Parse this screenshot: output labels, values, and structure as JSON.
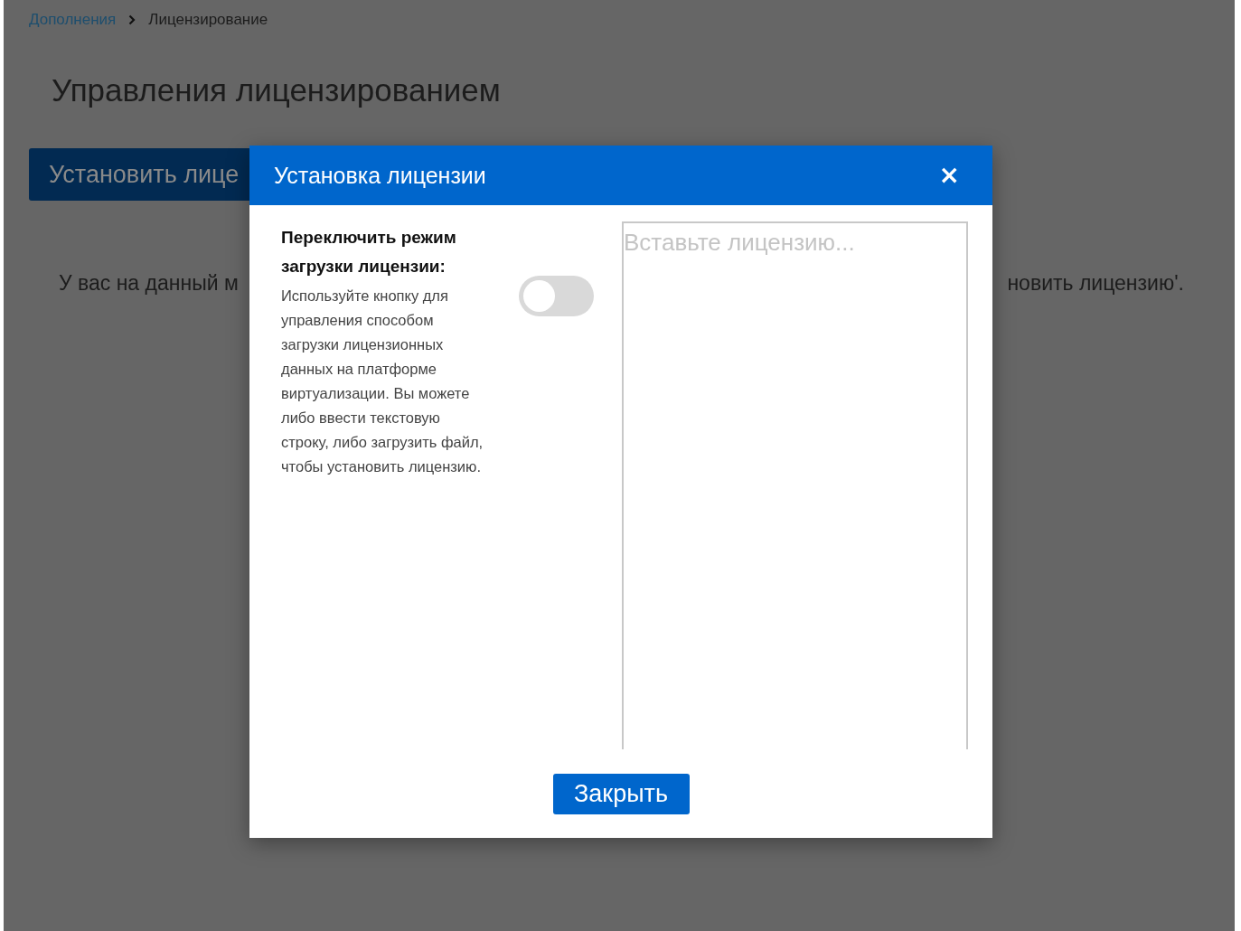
{
  "breadcrumb": [
    {
      "label": "Дополнения",
      "kind": "link"
    },
    {
      "label": "Лицензирование",
      "kind": "current"
    }
  ],
  "page_title": "Управления лицензированием",
  "install_button": "Установить лице",
  "notice": {
    "left": "У вас на данный м",
    "right": "новить лицензию'."
  },
  "modal": {
    "title": "Установка лицензии",
    "close_icon": "×",
    "mode_title": "Переключить режим загрузки лицензии:",
    "mode_description": "Используйте кнопку для управления способом загрузки лицензионных данных на платформе виртуализации. Вы можете либо ввести текстовую строку, либо загрузить файл, чтобы установить лицензию.",
    "mode_toggle": {
      "on": false
    },
    "license_field": {
      "placeholder": "Вставьте лицензию..."
    },
    "close_button": "Закрыть"
  }
}
